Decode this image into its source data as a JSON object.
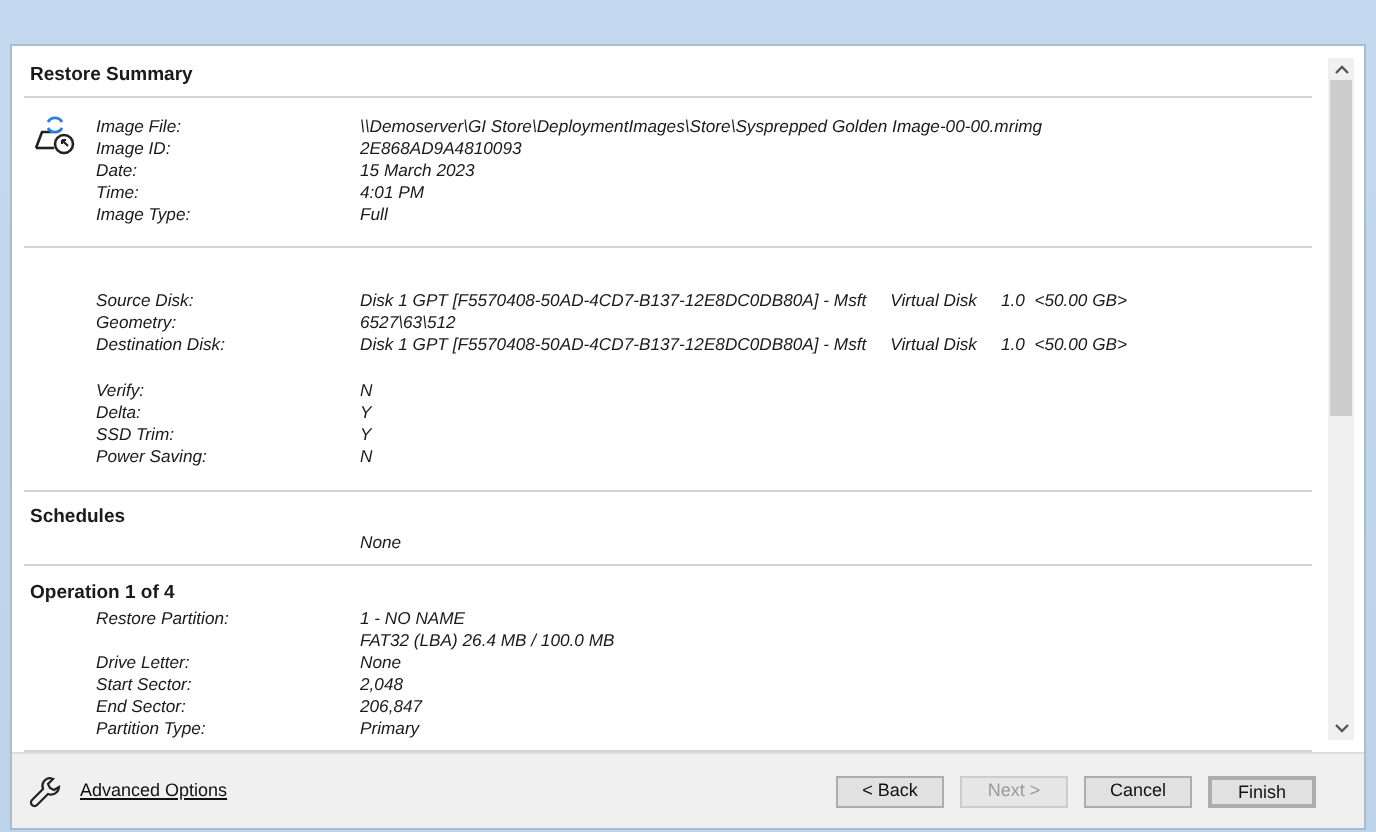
{
  "title": "Restore Summary",
  "image_info": [
    {
      "label": "Image File:",
      "value": "\\\\Demoserver\\GI Store\\DeploymentImages\\Store\\Sysprepped Golden Image-00-00.mrimg"
    },
    {
      "label": "Image ID:",
      "value": "2E868AD9A4810093"
    },
    {
      "label": "Date:",
      "value": "15 March 2023"
    },
    {
      "label": "Time:",
      "value": "4:01 PM"
    },
    {
      "label": "Image Type:",
      "value": "Full"
    }
  ],
  "disk_info": [
    {
      "label": "Source Disk:",
      "parts": [
        "Disk 1 GPT [F5570408-50AD-4CD7-B137-12E8DC0DB80A] - Msft",
        "Virtual Disk",
        "1.0  <50.00 GB>"
      ]
    },
    {
      "label": "Geometry:",
      "parts": [
        "6527\\63\\512"
      ]
    },
    {
      "label": "Destination Disk:",
      "parts": [
        "Disk 1 GPT [F5570408-50AD-4CD7-B137-12E8DC0DB80A] - Msft",
        "Virtual Disk",
        "1.0  <50.00 GB>"
      ]
    }
  ],
  "options": [
    {
      "label": "Verify:",
      "value": "N"
    },
    {
      "label": "Delta:",
      "value": "Y"
    },
    {
      "label": "SSD Trim:",
      "value": "Y"
    },
    {
      "label": "Power Saving:",
      "value": "N"
    }
  ],
  "schedules": {
    "heading": "Schedules",
    "value": "None"
  },
  "operation": {
    "heading": "Operation 1 of 4",
    "rows": [
      {
        "label": "Restore Partition:",
        "values": [
          "1 - NO NAME",
          "FAT32 (LBA) 26.4 MB / 100.0 MB"
        ]
      },
      {
        "label": "Drive Letter:",
        "values": [
          "None"
        ]
      },
      {
        "label": "Start Sector:",
        "values": [
          "2,048"
        ]
      },
      {
        "label": "End Sector:",
        "values": [
          "206,847"
        ]
      },
      {
        "label": "Partition Type:",
        "values": [
          "Primary"
        ]
      }
    ]
  },
  "advanced_options": "Advanced Options",
  "buttons": [
    {
      "label": "< Back",
      "disabled": false,
      "default": false
    },
    {
      "label": "Next >",
      "disabled": true,
      "default": false
    },
    {
      "label": "Cancel",
      "disabled": false,
      "default": false
    },
    {
      "label": "Finish",
      "disabled": false,
      "default": true
    }
  ]
}
